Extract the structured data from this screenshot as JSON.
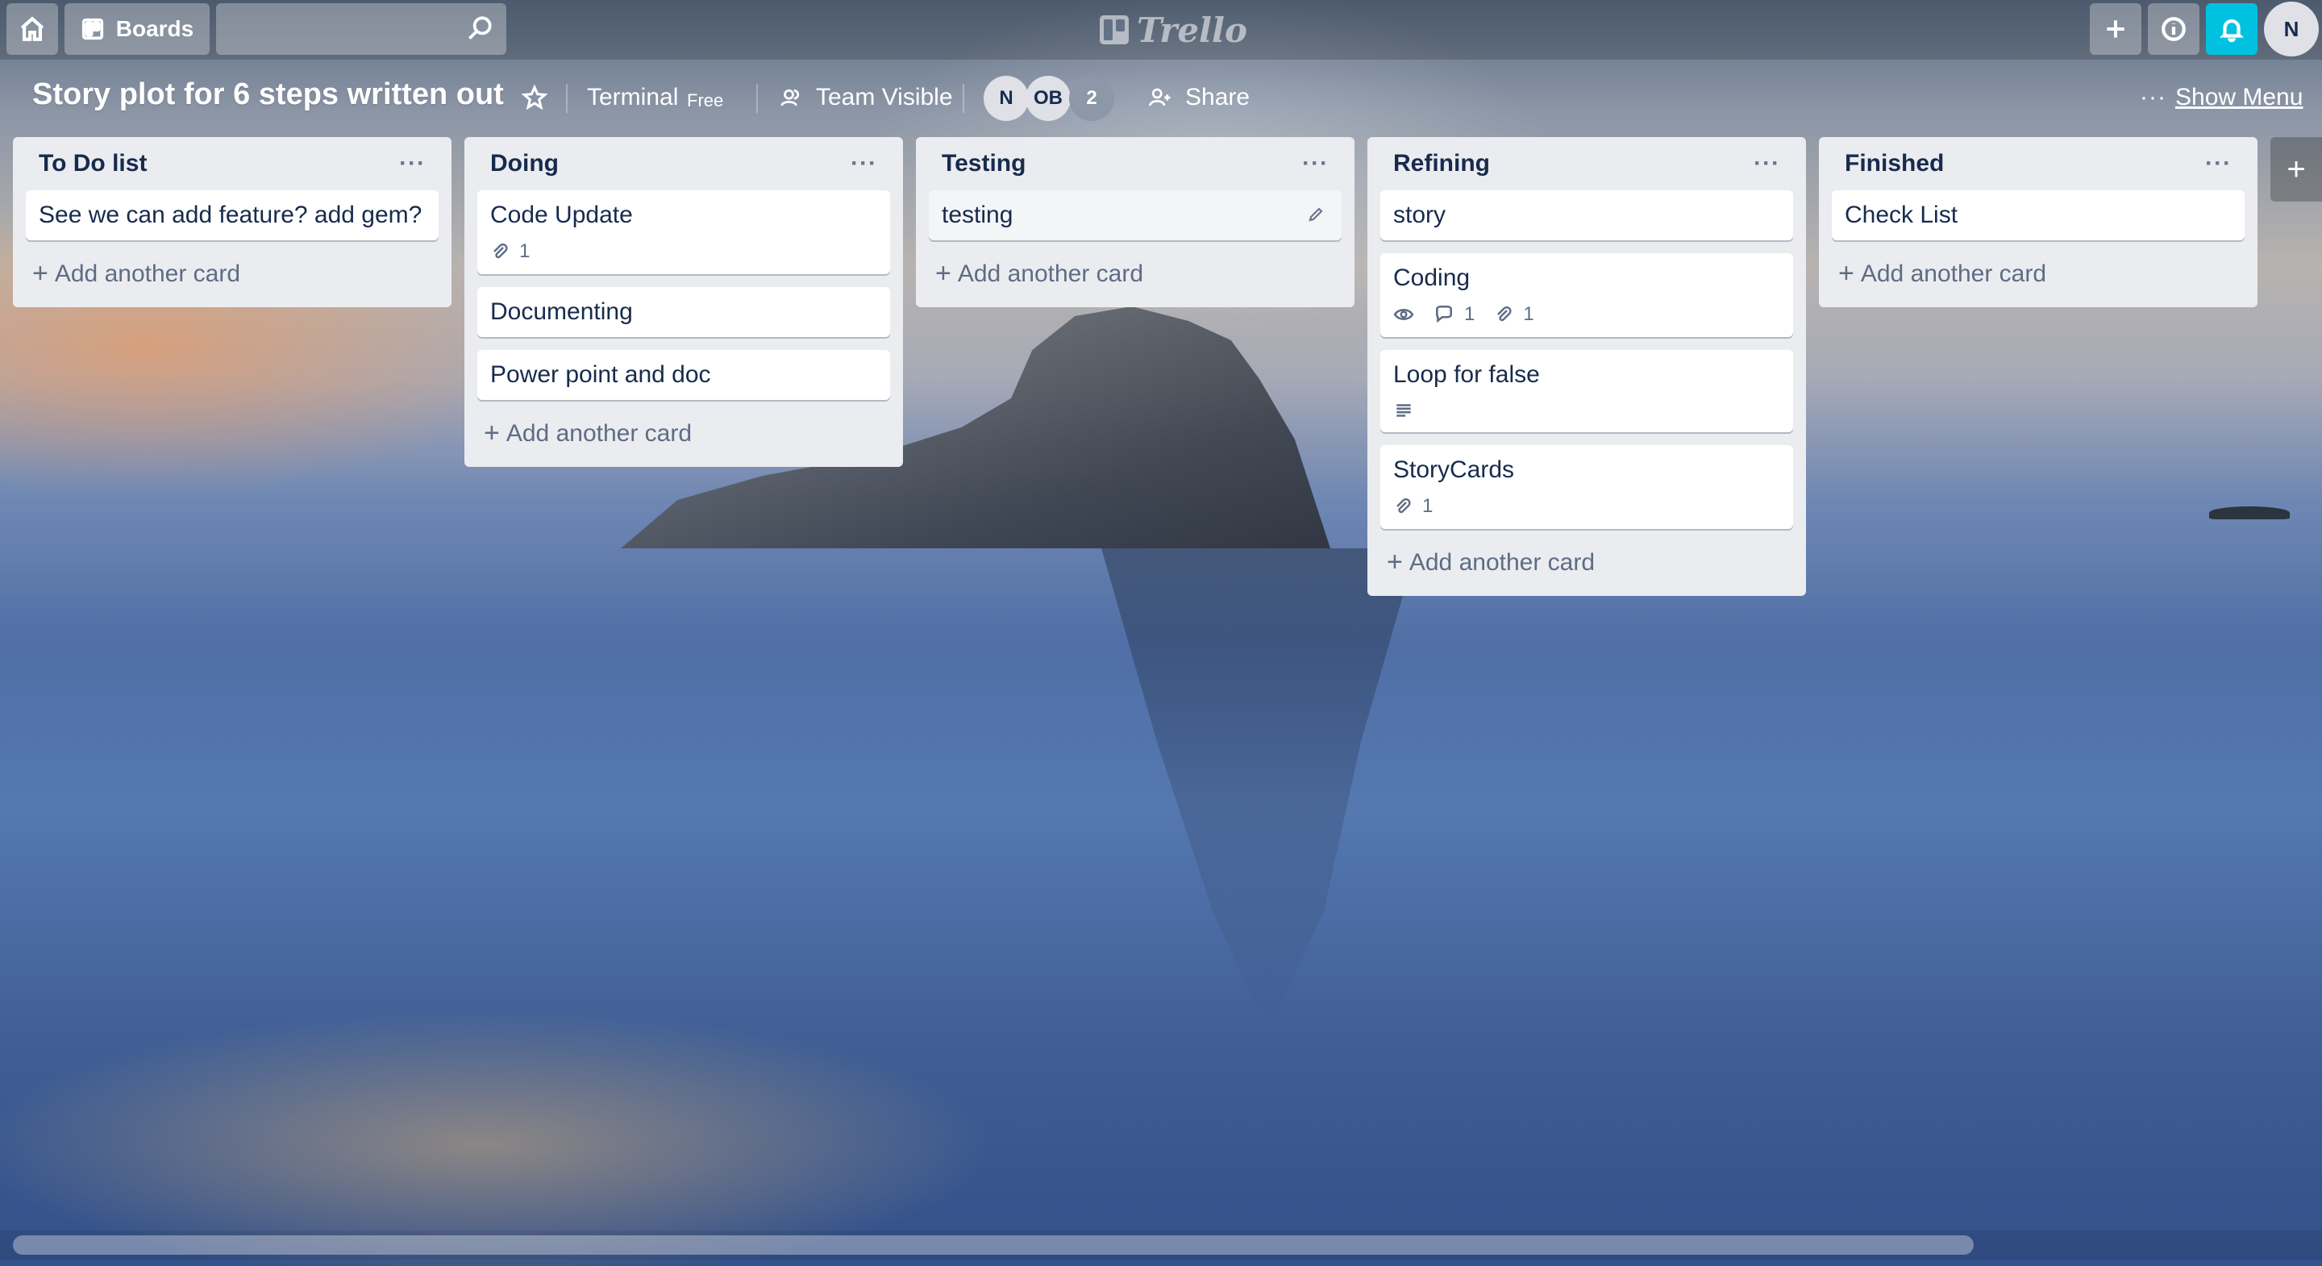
{
  "header": {
    "boards_label": "Boards",
    "search": {
      "value": "",
      "placeholder": ""
    },
    "logo_text": "Trello",
    "avatar_initial": "N"
  },
  "board": {
    "title": "Story plot for 6 steps written out",
    "team": "Terminal",
    "plan_badge": "Free",
    "visibility": "Team Visible",
    "members": [
      "N",
      "OB"
    ],
    "member_count": "2",
    "share_label": "Share",
    "show_menu_label": "Show Menu"
  },
  "lists": [
    {
      "title": "To Do list",
      "cards": [
        {
          "title": "See we can add feature? add gem?"
        }
      ],
      "add_card_label": "Add another card"
    },
    {
      "title": "Doing",
      "cards": [
        {
          "title": "Code Update",
          "attachments": "1"
        },
        {
          "title": "Documenting"
        },
        {
          "title": "Power point and doc"
        }
      ],
      "add_card_label": "Add another card"
    },
    {
      "title": "Testing",
      "cards": [
        {
          "title": "testing"
        }
      ],
      "add_card_label": "Add another card"
    },
    {
      "title": "Refining",
      "cards": [
        {
          "title": "story"
        },
        {
          "title": "Coding",
          "comments": "1",
          "attachments": "1"
        },
        {
          "title": "Loop for false"
        },
        {
          "title": "StoryCards",
          "attachments": "1"
        }
      ],
      "add_card_label": "Add another card"
    },
    {
      "title": "Finished",
      "cards": [
        {
          "title": "Check List"
        }
      ],
      "add_card_label": "Add another card"
    }
  ],
  "colors": {
    "notification_accent": "#00c2e0",
    "list_bg": "#ebecf0",
    "text": "#172b4d"
  }
}
